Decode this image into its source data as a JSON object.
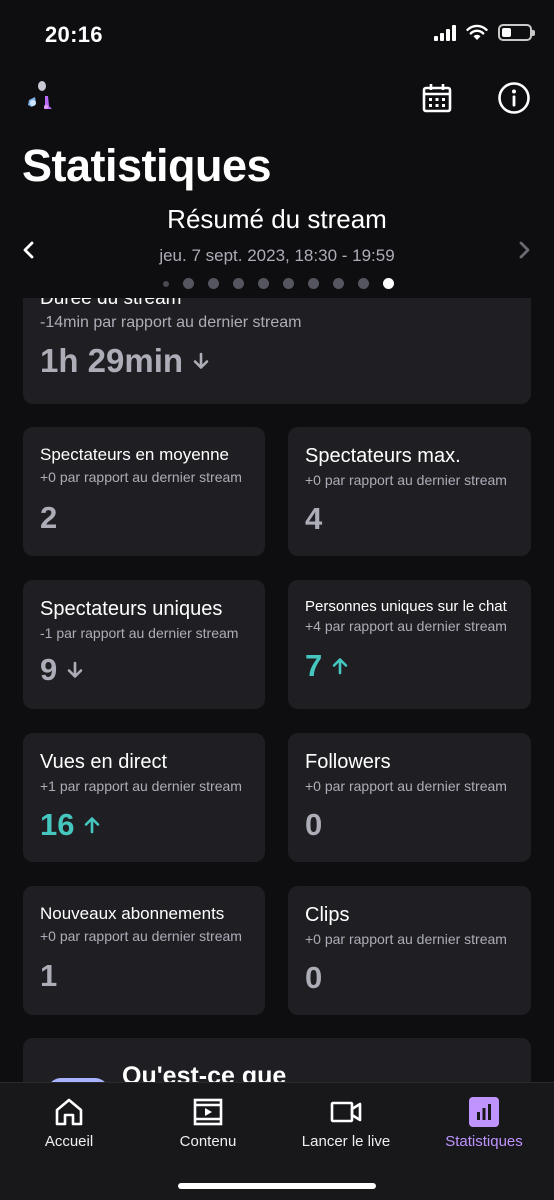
{
  "status_bar": {
    "time": "20:16",
    "battery_level": 0.35
  },
  "header": {
    "title": "Statistiques",
    "icons": [
      "calendar-icon",
      "info-icon"
    ]
  },
  "summary": {
    "title": "Résumé du stream",
    "date": "jeu. 7 sept. 2023, 18:30 - 19:59",
    "page_count": 10,
    "active_page": 10
  },
  "stats": {
    "duration": {
      "title": "Durée du stream",
      "sub": "-14min par rapport au dernier stream",
      "value": "1h 29min",
      "trend": "down"
    },
    "avg_viewers": {
      "title": "Spectateurs en moyenne",
      "sub": "+0 par rapport au dernier stream",
      "value": "2",
      "trend": "none"
    },
    "max_viewers": {
      "title": "Spectateurs max.",
      "sub": "+0 par rapport au dernier stream",
      "value": "4",
      "trend": "none"
    },
    "unique_viewers": {
      "title": "Spectateurs uniques",
      "sub": "-1 par rapport au dernier stream",
      "value": "9",
      "trend": "down"
    },
    "unique_chatters": {
      "title": "Personnes uniques sur le chat",
      "sub": "+4 par rapport au dernier stream",
      "value": "7",
      "trend": "up"
    },
    "live_views": {
      "title": "Vues en direct",
      "sub": "+1 par rapport au dernier stream",
      "value": "16",
      "trend": "up"
    },
    "followers": {
      "title": "Followers",
      "sub": "+0 par rapport au dernier stream",
      "value": "0",
      "trend": "none"
    },
    "new_subs": {
      "title": "Nouveaux abonnements",
      "sub": "+0 par rapport au dernier stream",
      "value": "1",
      "trend": "none"
    },
    "clips": {
      "title": "Clips",
      "sub": "+0 par rapport au dernier stream",
      "value": "0",
      "trend": "none"
    }
  },
  "promo": {
    "title": "Qu'est-ce que"
  },
  "bottom_nav": {
    "items": [
      {
        "label": "Accueil",
        "icon": "home-icon"
      },
      {
        "label": "Contenu",
        "icon": "film-icon"
      },
      {
        "label": "Lancer le live",
        "icon": "video-camera-icon"
      },
      {
        "label": "Statistiques",
        "icon": "stats-icon"
      }
    ],
    "active_index": 3
  },
  "colors": {
    "background": "#0e0e10",
    "card": "#1f1f23",
    "up": "#45c6bf",
    "accent": "#bf94ff",
    "muted": "#adadb8"
  }
}
